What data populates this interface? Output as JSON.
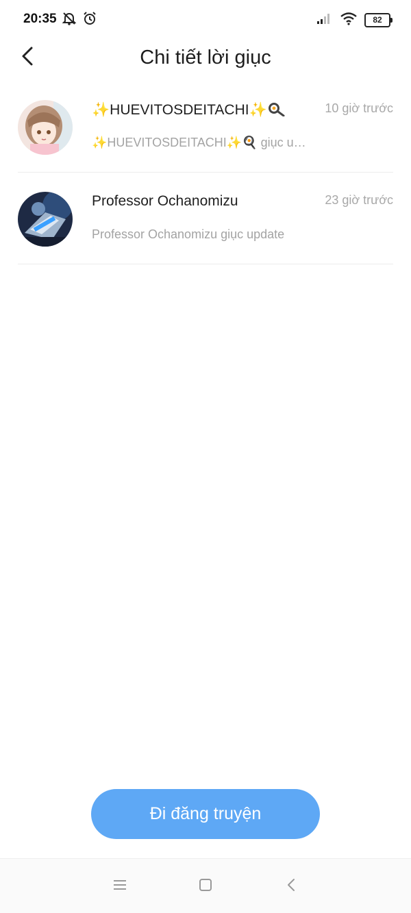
{
  "status_bar": {
    "time": "20:35",
    "battery_level": "82",
    "icons": [
      "mute-bell-icon",
      "alarm-icon",
      "signal-icon",
      "wifi-icon",
      "battery-icon"
    ]
  },
  "header": {
    "title": "Chi tiết lời giục",
    "back_icon": "back-chevron-icon"
  },
  "list": {
    "items": [
      {
        "name": "HUEVITOSDEITACHI",
        "message": "✨HUEVITOSDEITACHI✨🍳 giục update",
        "time": "10 giờ trước",
        "decorations": [
          "sparkle-icon",
          "sparkle-icon",
          "frying-pan-icon"
        ]
      },
      {
        "name": "Professor Ochanomizu",
        "message": "Professor Ochanomizu giục update",
        "time": "23 giờ trước",
        "decorations": []
      }
    ]
  },
  "cta": {
    "label": "Đi đăng truyện"
  },
  "nav_bar": {
    "icons": [
      "menu-icon",
      "home-square-icon",
      "back-triangle-icon"
    ]
  },
  "colors": {
    "accent": "#5ea8f5",
    "sparkle": "#f5c400",
    "subtext": "#a3a3a3",
    "divider": "#ececec"
  }
}
